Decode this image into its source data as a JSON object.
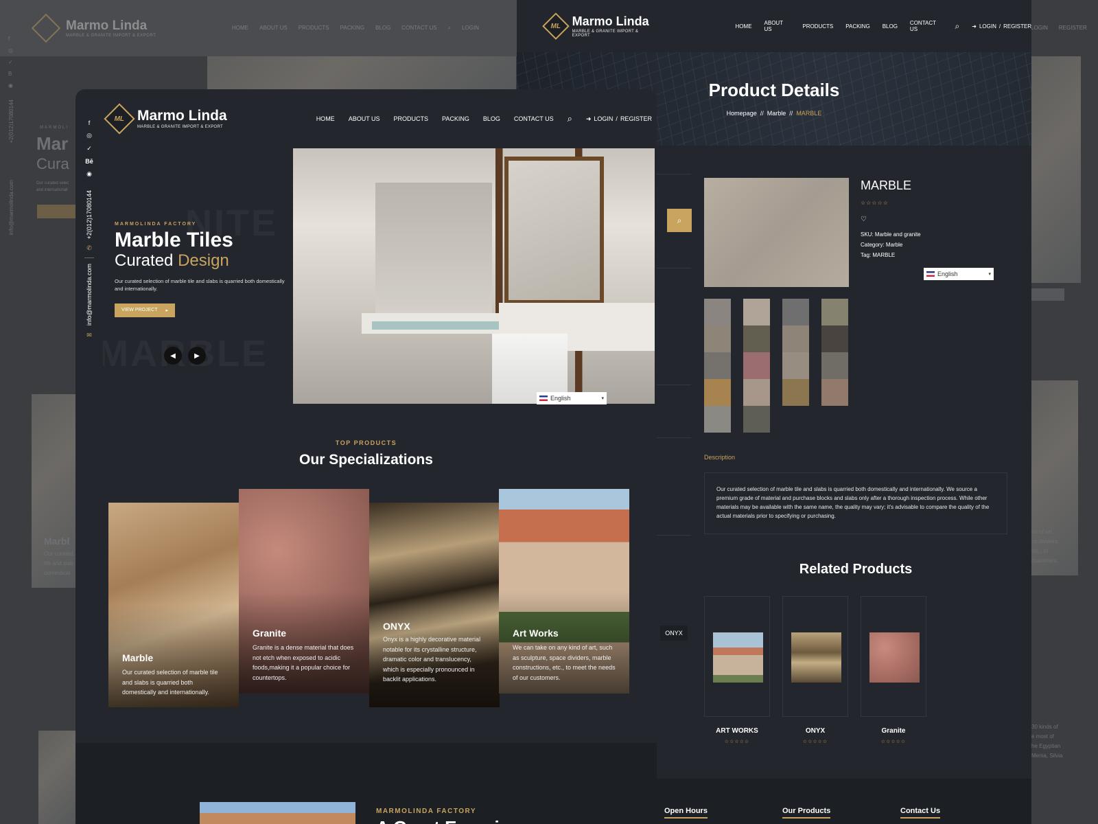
{
  "brand": {
    "name": "Marmo Linda",
    "tagline": "MARBLE & GRANITE IMPORT & EXPORT",
    "mark": "ML"
  },
  "nav": {
    "home": "HOME",
    "about": "ABOUT US",
    "products": "PRODUCTS",
    "packing": "PACKING",
    "blog": "BLOG",
    "contact": "CONTACT US",
    "login": "LOGIN",
    "sep": "/",
    "register": "REGISTER"
  },
  "colors": {
    "accent": "#c9a45f",
    "dark": "#23272d"
  },
  "social": {
    "phone": "+2(012)17080144",
    "email": "info@marmolinda.com",
    "icons": [
      "facebook-icon",
      "instagram-icon",
      "twitter-icon",
      "behance-icon",
      "dribbble-icon"
    ]
  },
  "hero": {
    "kicker": "MARMOLINDA FACTORY",
    "title": "Marble Tiles",
    "subtitle_plain": "Curated ",
    "subtitle_accent": "Design",
    "text": "Our curated selection of marble tile and slabs is quarried both domestically and internationally.",
    "button": "VIEW PROJECT",
    "ghost_top": "NITE",
    "ghost_bottom": "MARBLE"
  },
  "language": {
    "label": "English"
  },
  "specializations": {
    "kicker": "TOP PRODUCTS",
    "title": "Our Specializations",
    "items": [
      {
        "title": "Marble",
        "text": "Our curated selection of marble tile and slabs is quarried both domestically and internationally."
      },
      {
        "title": "Granite",
        "text": "Granite is a dense material that does not etch when exposed to acidic foods,making it a popular choice for countertops."
      },
      {
        "title": "ONYX",
        "text": "Onyx is a highly decorative material notable for its crystalline structure, dramatic color and translucency, which is especially pronounced in backlit applications."
      },
      {
        "title": "Art Works",
        "text": "We can take on any kind of art, such as sculpture, space dividers, marble constructions, etc., to meet the needs of our customers."
      }
    ]
  },
  "experience": {
    "kicker": "MARMOLINDA FACTORY",
    "title": "A Great Experience"
  },
  "product_page": {
    "title": "Product Details",
    "breadcrumbs": [
      "Homepage",
      "//",
      "Marble",
      "//",
      "MARBLE"
    ],
    "product_name": "MARBLE",
    "stars": "☆☆☆☆☆",
    "sku_label": "SKU:",
    "sku": "Marble and granite",
    "category_label": "Category:",
    "category": "Marble",
    "tag_label": "Tag:",
    "tag": "MARBLE",
    "description_label": "Description",
    "description": "Our curated selection of marble tile and slabs is quarried both domestically and internationally. We source a premium grade of material and purchase blocks and slabs only after a thorough inspection process. While other materials may be available with the same name, the quality may vary; it's advisable to compare the quality of the actual materials prior to specifying or purchasing.",
    "related_title": "Related Products",
    "related": [
      {
        "name": "ART WORKS",
        "stars": "☆☆☆☆☆"
      },
      {
        "name": "ONYX",
        "stars": "☆☆☆☆☆"
      },
      {
        "name": "Granite",
        "stars": "☆☆☆☆☆"
      }
    ],
    "sidebar_tag": "ONYX",
    "footer": [
      "Open Hours",
      "Our Products",
      "Contact Us"
    ]
  },
  "background_fragments": {
    "left_title": "Mar",
    "left_sub": "Cura",
    "left_text_1": "Our curated selec",
    "left_text_2": "and internationall",
    "card_title": "Marbl",
    "card_text_1": "Our curated",
    "card_text_2": "tile and slab",
    "card_text_3": "domestical",
    "right_text_1": "nd of art,",
    "right_text_2": "ce dividers,",
    "right_text_3": "etc., to",
    "right_text_4": "customers.",
    "right_text_5": "30 kinds of",
    "right_text_6": "e most of",
    "right_text_7": "he Egyptian",
    "right_text_8": "Menia, Silvia",
    "vert_phone": "+2(012)17080144",
    "vert_email": "info@marmolinda.com",
    "vert_kicker": "MARMOLI"
  }
}
